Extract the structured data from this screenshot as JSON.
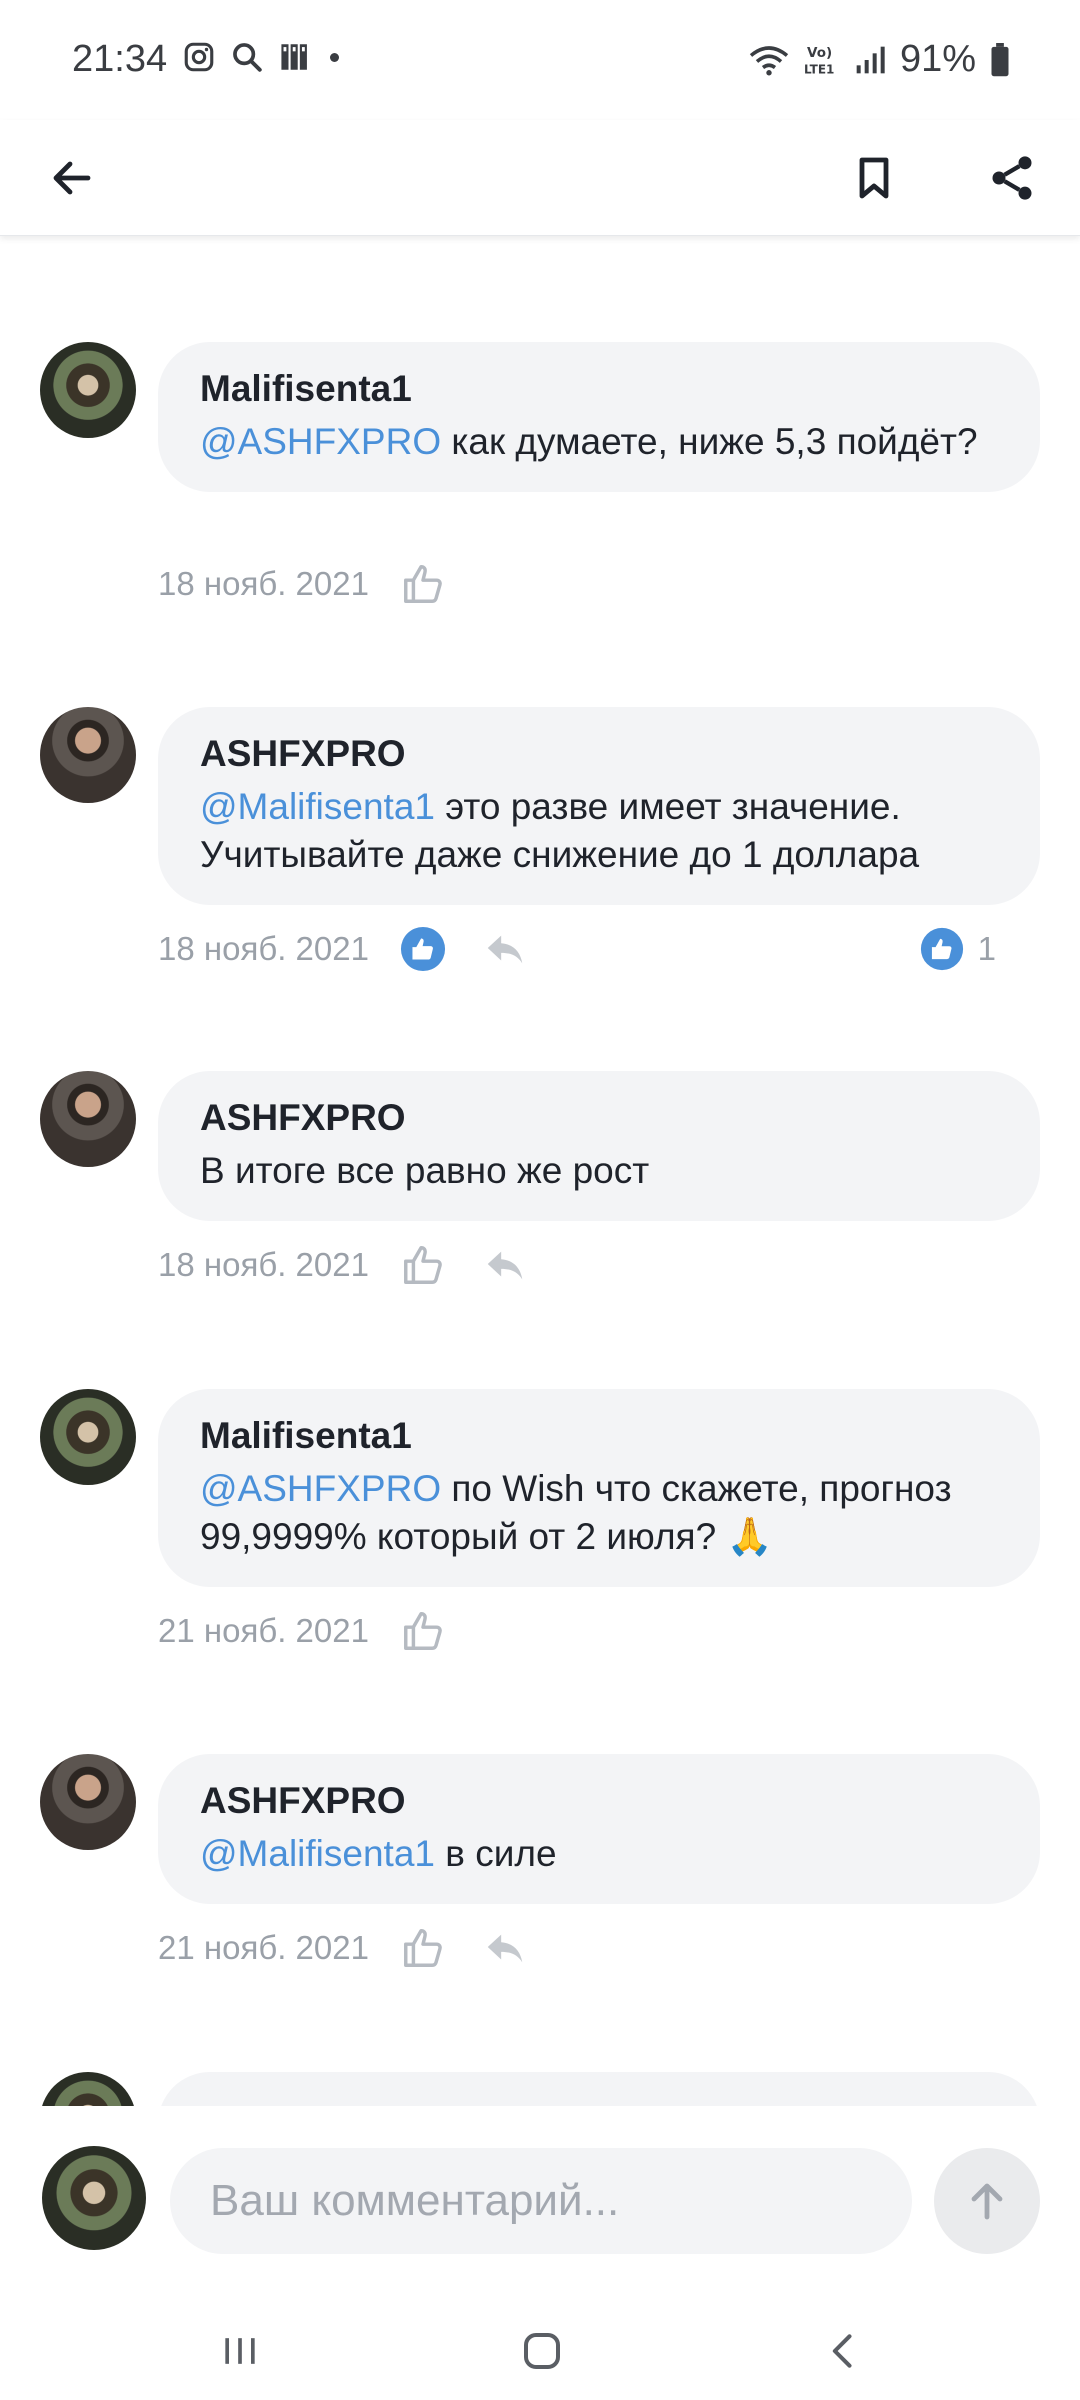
{
  "status_bar": {
    "time": "21:34",
    "battery": "91%",
    "icons": [
      "instagram-icon",
      "search-icon",
      "library-icon",
      "wifi-icon",
      "volte-icon",
      "signal-icon",
      "battery-icon"
    ]
  },
  "header": {
    "icons": [
      "back-arrow-icon",
      "bookmark-icon",
      "share-icon"
    ]
  },
  "colors": {
    "mention": "#4a90d9",
    "bubble": "#f3f4f6",
    "meta": "#9aa0a8",
    "like_active": "#4a90d9"
  },
  "comments": [
    {
      "author": "Malifisenta1",
      "mention": "@ASHFXPRO",
      "text": " как думаете, ниже 5,3 пойдёт?",
      "date": "18 нояб. 2021",
      "liked": false,
      "has_reply": false,
      "likes": ""
    },
    {
      "author": "ASHFXPRO",
      "mention": "@Malifisenta1",
      "text": " это разве имеет значение. Учитывайте даже снижение до 1 доллара",
      "date": "18 нояб. 2021",
      "liked": true,
      "has_reply": true,
      "likes": "1"
    },
    {
      "author": "ASHFXPRO",
      "mention": "",
      "text": "В итоге все равно же рост",
      "date": "18 нояб. 2021",
      "liked": false,
      "has_reply": true,
      "likes": ""
    },
    {
      "author": "Malifisenta1",
      "mention": "@ASHFXPRO",
      "text": " по Wish что скажете, прогноз 99,9999% который от 2 июля? 🙏",
      "date": "21 нояб. 2021",
      "liked": false,
      "has_reply": false,
      "likes": ""
    },
    {
      "author": "ASHFXPRO",
      "mention": "@Malifisenta1",
      "text": " в силе",
      "date": "21 нояб. 2021",
      "liked": false,
      "has_reply": true,
      "likes": ""
    }
  ],
  "composer": {
    "placeholder": "Ваш комментарий...",
    "value": ""
  },
  "navbar": {
    "icons": [
      "recent-apps-icon",
      "home-icon",
      "back-icon"
    ]
  }
}
